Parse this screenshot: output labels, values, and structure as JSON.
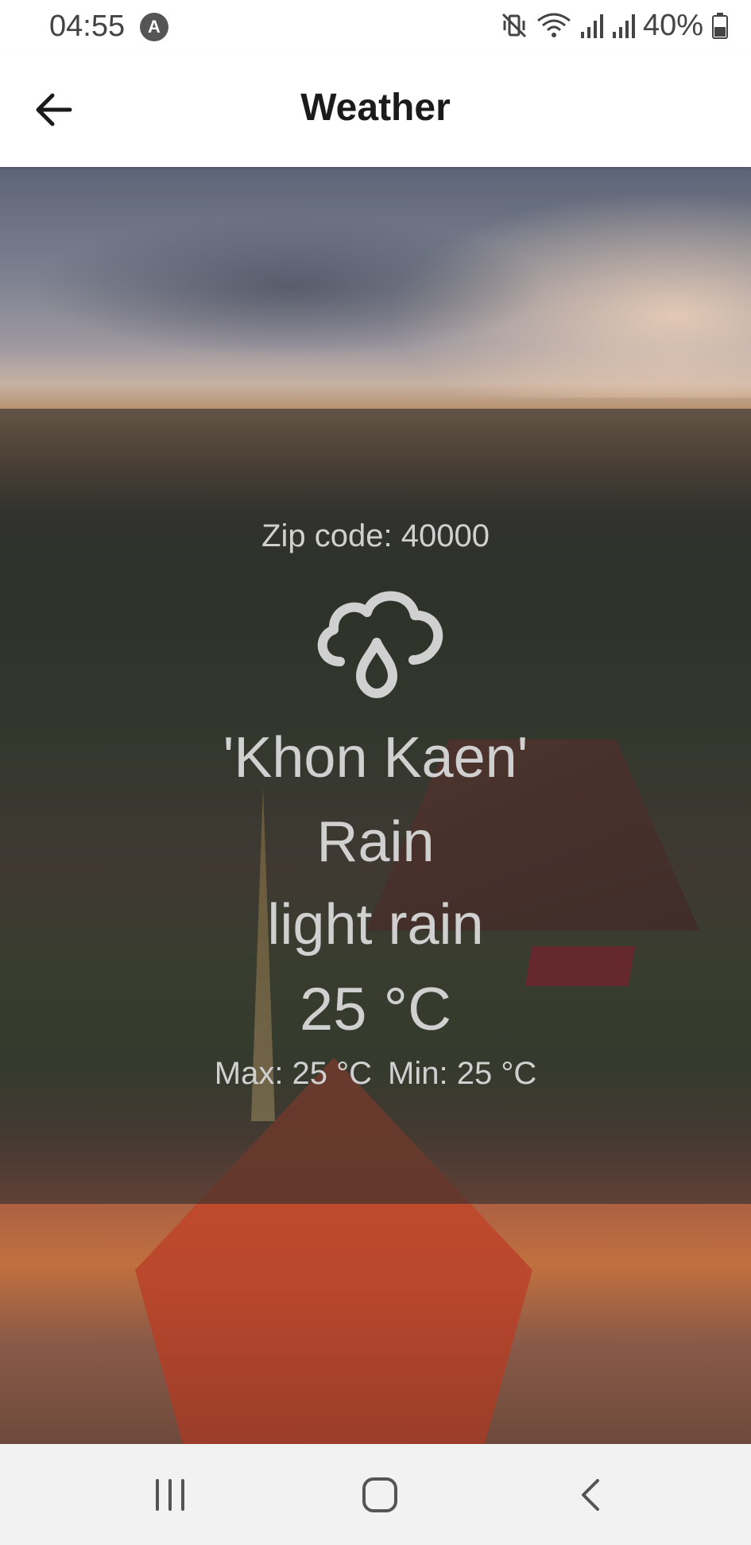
{
  "status_bar": {
    "time": "04:55",
    "app_badge": "A",
    "battery": "40%",
    "icons": [
      "mute-vibrate-icon",
      "wifi-icon",
      "signal-icon",
      "signal-icon",
      "battery-icon"
    ]
  },
  "app_bar": {
    "title": "Weather",
    "back_icon": "arrow-left-icon"
  },
  "weather": {
    "zip_label": "Zip code: 40000",
    "icon": "rain-cloud-icon",
    "city": "'Khon Kaen'",
    "main": "Rain",
    "description": "light rain",
    "temperature": "25 °C",
    "max": "Max: 25 °C",
    "min": "Min: 25 °C"
  },
  "nav_bar": {
    "icons": [
      "recent-apps-icon",
      "home-icon",
      "back-icon"
    ]
  },
  "colors": {
    "overlay": "#2d2d2d",
    "text": "#d0d0d0",
    "nav_background": "#f2f2f2"
  }
}
